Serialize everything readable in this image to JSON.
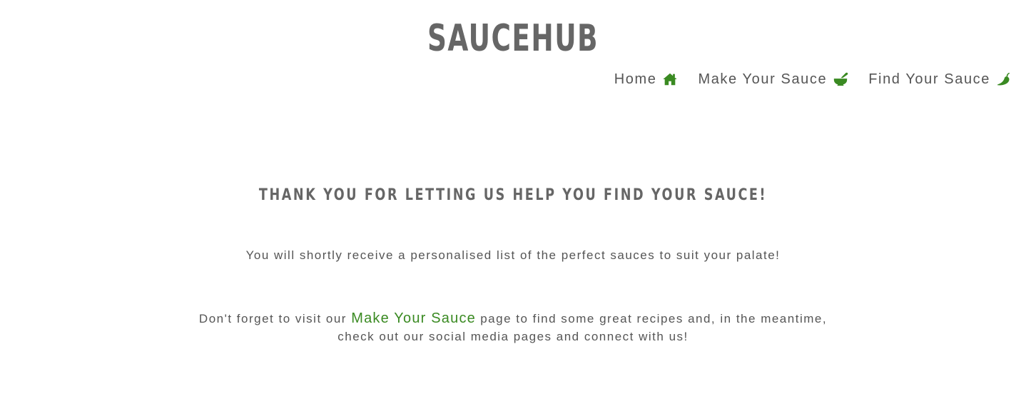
{
  "header": {
    "brand": "SAUCEHUB"
  },
  "nav": {
    "items": [
      {
        "label": "Home",
        "icon": "home-icon"
      },
      {
        "label": "Make Your Sauce",
        "icon": "mortar-pestle-icon"
      },
      {
        "label": "Find Your Sauce",
        "icon": "pepper-hot-icon"
      }
    ]
  },
  "main": {
    "heading": "THANK YOU FOR LETTING US HELP YOU FIND YOUR SAUCE!",
    "subtitle": "You will shortly receive a personalised list of the perfect sauces to suit your palate!",
    "reminder": {
      "before": "Don't forget to visit our ",
      "link": "Make Your Sauce",
      "after_line1": " page to find some great recipes and, in the meantime,",
      "line2": "check out our social media pages and connect with us!"
    }
  },
  "colors": {
    "accent": "#3a8a22",
    "text": "#555555",
    "heading": "#666666"
  }
}
